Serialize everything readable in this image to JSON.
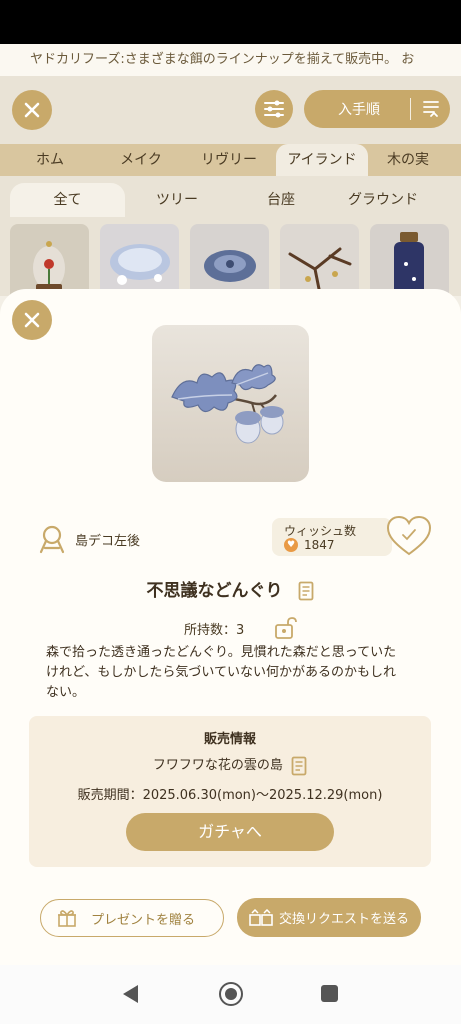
{
  "ticker": {
    "text": "ヤドカリフーズ:さまざまな餌のラインナップを揃えて販売中。 お"
  },
  "background": {
    "sort_label": "入手順",
    "category_tabs": [
      "ホム",
      "メイク",
      "リヴリー",
      "アイランド",
      "木の実"
    ],
    "active_category": "アイランド",
    "sub_tabs": [
      "全て",
      "ツリー",
      "台座",
      "グラウンド"
    ],
    "active_sub_tab": "全て"
  },
  "item": {
    "deco_position": "島デコ左後",
    "wish_label": "ウィッシュ数",
    "wish_count": "1847",
    "name": "不思議などんぐり",
    "owned": "所持数：3",
    "description": "森で拾った透き通ったどんぐり。見慣れた森だと思っていたけれど、もしかしたら気づいていない何かがあるのかもしれない。"
  },
  "sale": {
    "title": "販売情報",
    "island": "フワフワな花の雲の島",
    "period": "販売期間：2025.06.30(mon)〜2025.12.29(mon)",
    "gacha_button": "ガチャへ"
  },
  "actions": {
    "present_button": "プレゼントを贈る",
    "exchange_button": "交換リクエストを送る"
  },
  "colors": {
    "accent": "#c8a96a",
    "sheet_background": "#fffdf8",
    "sale_box": "#f7eedf",
    "wish_heart": "#e99a45"
  },
  "icons": [
    "close-icon",
    "filter-icon",
    "sort-icon",
    "deco-position-icon",
    "heart-check-icon",
    "document-icon",
    "unlocked-icon",
    "gift-icon",
    "exchange-icon",
    "nav-back-icon",
    "nav-home-icon",
    "nav-recent-icon"
  ]
}
